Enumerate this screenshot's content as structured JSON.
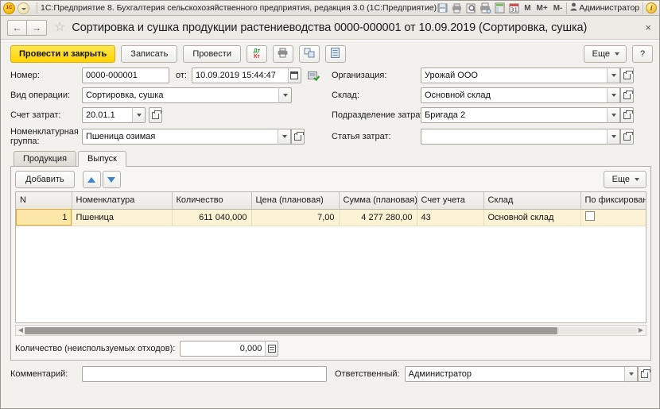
{
  "titlebar": {
    "app_title": "1С:Предприятие 8. Бухгалтерия сельскохозяйственного предприятия, редакция 3.0  (1С:Предприятие)",
    "logo_text": "1C",
    "mem_buttons": [
      "M",
      "M+",
      "M-"
    ],
    "user_name": "Администратор",
    "icons": [
      "save-icon",
      "print-icon",
      "preview-icon",
      "print-setup-icon",
      "calculator-icon",
      "calendar-icon"
    ]
  },
  "dochead": {
    "back_label": "←",
    "forward_label": "→",
    "favorite_icon": "star-icon",
    "title": "Сортировка и сушка продукции растениеводства 0000-000001 от 10.09.2019 (Сортировка, сушка)",
    "close_label": "×"
  },
  "toolbar": {
    "post_and_close_label": "Провести и закрыть",
    "write_label": "Записать",
    "post_label": "Провести",
    "dt_label": "Дт",
    "kt_label": "Кт",
    "more_label": "Еще",
    "help_label": "?"
  },
  "form": {
    "number": {
      "label": "Номер:",
      "value": "0000-000001"
    },
    "date": {
      "label": "от:",
      "value": "10.09.2019 15:44:47"
    },
    "operation_type": {
      "label": "Вид операции:",
      "value": "Сортировка, сушка"
    },
    "cost_account": {
      "label": "Счет затрат:",
      "value": "20.01.1"
    },
    "nomenclature_group": {
      "label": "Номенклатурная группа:",
      "value": "Пшеница озимая"
    },
    "organization": {
      "label": "Организация:",
      "value": "Урожай ООО"
    },
    "warehouse": {
      "label": "Склад:",
      "value": "Основной склад"
    },
    "cost_division": {
      "label": "Подразделение затрат:",
      "value": "Бригада 2"
    },
    "cost_item": {
      "label": "Статья затрат:",
      "value": ""
    }
  },
  "tabs": [
    {
      "label": "Продукция",
      "active": false
    },
    {
      "label": "Выпуск",
      "active": true
    }
  ],
  "table_toolbar": {
    "add_label": "Добавить",
    "move_up_icon": "arrow-up-icon",
    "move_down_icon": "arrow-down-icon",
    "more_label": "Еще"
  },
  "table": {
    "columns": [
      "N",
      "Номенклатура",
      "Количество",
      "Цена (плановая)",
      "Сумма (плановая)",
      "Счет учета",
      "Склад",
      "По фиксирован"
    ],
    "rows": [
      {
        "n": "1",
        "nomenclature": "Пшеница",
        "quantity": "611 040,000",
        "price": "7,00",
        "amount": "4 277 280,00",
        "account": "43",
        "warehouse": "Основной склад",
        "fixed_checked": false,
        "selected": true
      }
    ]
  },
  "waste": {
    "label": "Количество (неиспользуемых отходов):",
    "value": "0,000"
  },
  "footer": {
    "comment_label": "Комментарий:",
    "comment_value": "",
    "responsible_label": "Ответственный:",
    "responsible_value": "Администратор"
  },
  "colors": {
    "accent_yellow": "#ffd400",
    "selected_row": "#fcf3d4",
    "n_cell": "#fbe7a8",
    "arrow_blue": "#3f86c8",
    "debit_green": "#2f9e2f",
    "credit_red": "#d03030"
  }
}
